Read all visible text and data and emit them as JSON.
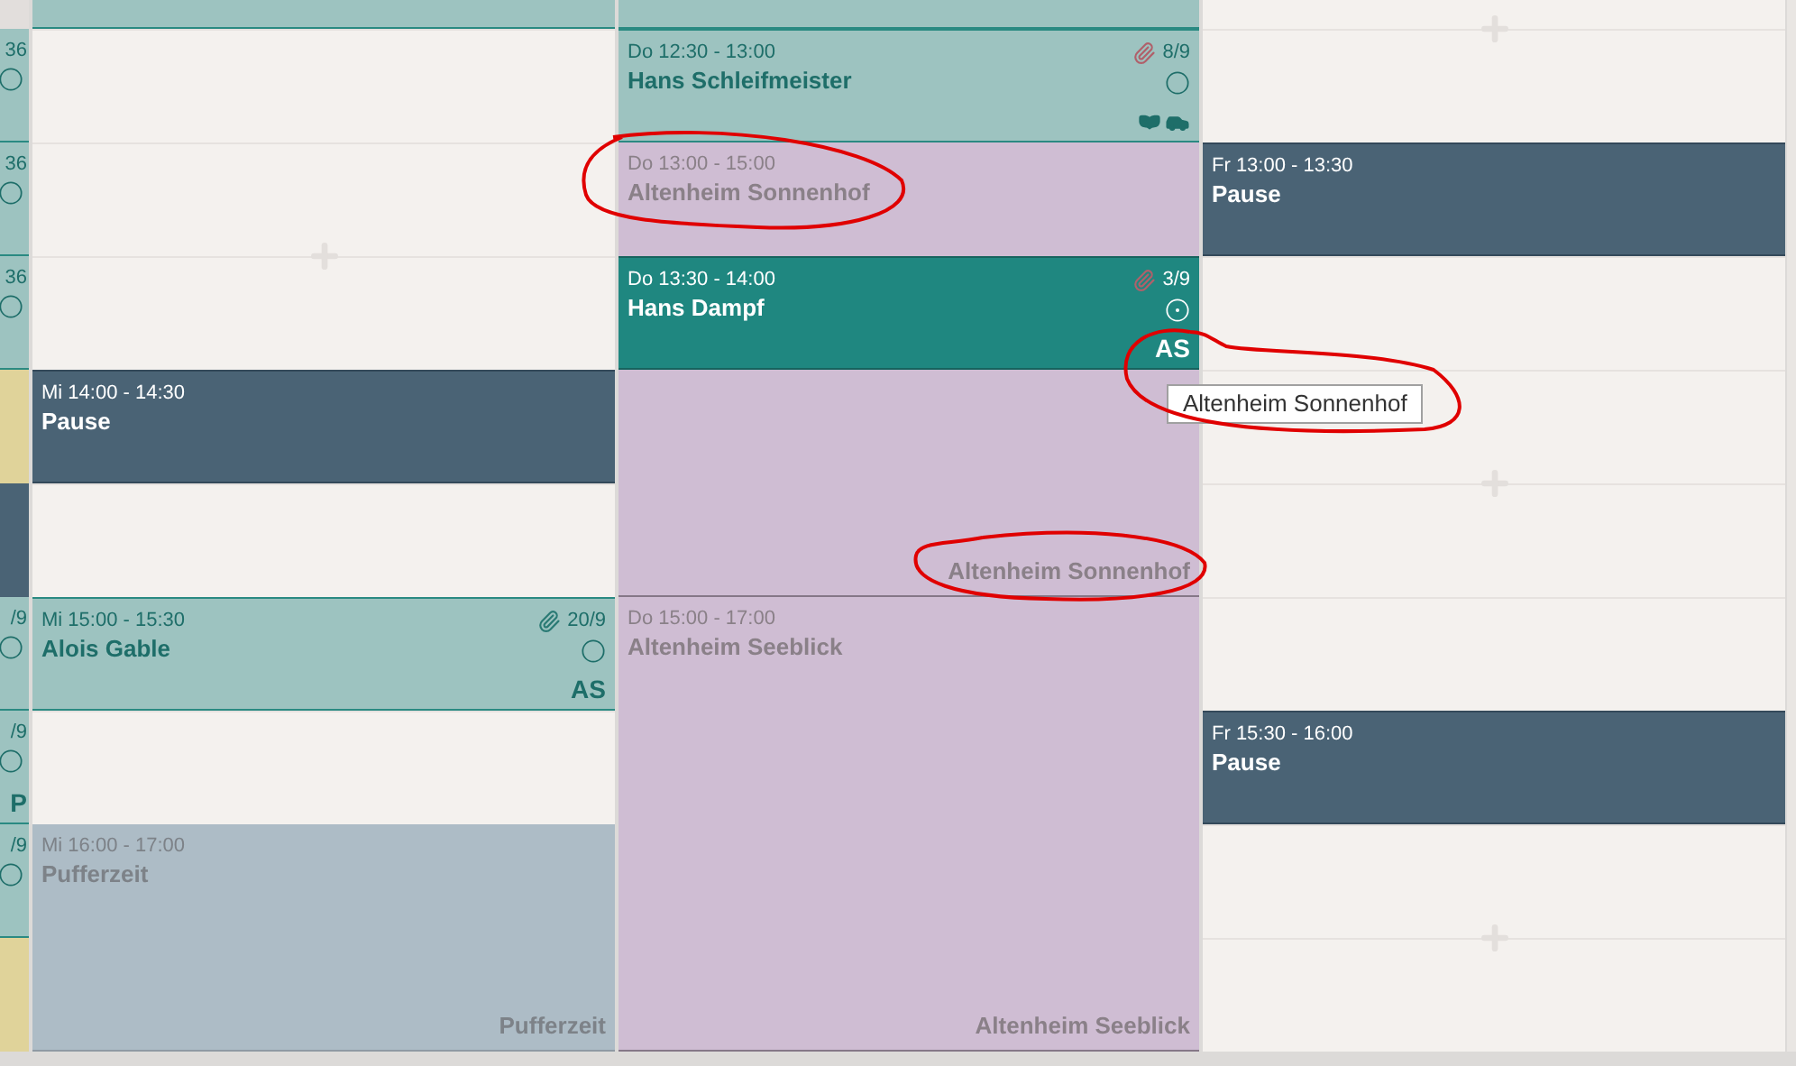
{
  "narrow_column": {
    "blocks": [
      {
        "kind": "empty"
      },
      {
        "kind": "appointment",
        "count": "36"
      },
      {
        "kind": "appointment",
        "count": "36"
      },
      {
        "kind": "appointment",
        "count": "36"
      },
      {
        "kind": "location"
      },
      {
        "kind": "pause"
      },
      {
        "kind": "appointment",
        "count": "/9"
      },
      {
        "kind": "appointment",
        "count": "/9",
        "initials": "P"
      },
      {
        "kind": "appointment",
        "count": "/9"
      },
      {
        "kind": "location"
      }
    ]
  },
  "days": [
    {
      "events": [
        {
          "kind": "cut"
        },
        {
          "kind": "pause",
          "time": "Mi 14:00 - 14:30",
          "title": "Pause"
        },
        {
          "kind": "appointment",
          "time": "Mi 15:00 - 15:30",
          "title": "Alois Gable",
          "attachment": {
            "count": "20/9",
            "color": "#2a7a74"
          },
          "selected": false,
          "icons": false,
          "initials": "AS"
        },
        {
          "kind": "buffer",
          "time": "Mi 16:00 - 17:00",
          "title": "Pufferzeit",
          "footer": "Pufferzeit"
        }
      ]
    },
    {
      "events": [
        {
          "kind": "cut"
        },
        {
          "kind": "appointment",
          "time": "Do 12:30 - 13:00",
          "title": "Hans Schleifmeister",
          "attachment": {
            "count": "8/9",
            "color": "#b0606a"
          },
          "selected": false,
          "icons": true
        },
        {
          "kind": "location",
          "time": "Do 13:00 - 15:00",
          "title": "Altenheim Sonnenhof",
          "footer": "Altenheim Sonnenhof"
        },
        {
          "kind": "appointment",
          "time": "Do 13:30 - 14:00",
          "title": "Hans Dampf",
          "attachment": {
            "count": "3/9",
            "color": "#b0606a"
          },
          "selected": true,
          "icons": false,
          "initials": "AS"
        },
        {
          "kind": "location",
          "time": "Do 15:00 - 17:00",
          "title": "Altenheim Seeblick",
          "footer": "Altenheim Seeblick"
        }
      ]
    },
    {
      "events": [
        {
          "kind": "pause",
          "time": "Fr 13:00 - 13:30",
          "title": "Pause"
        },
        {
          "kind": "pause",
          "time": "Fr 15:30 - 16:00",
          "title": "Pause"
        }
      ]
    }
  ],
  "tooltip": {
    "text": "Altenheim Sonnenhof"
  }
}
